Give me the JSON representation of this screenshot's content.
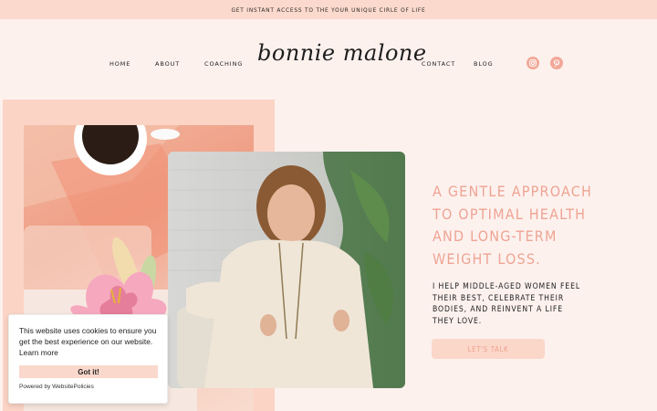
{
  "announcement": {
    "text": "GET INSTANT ACCESS TO THE YOUR UNIQUE CIRLE OF LIFE"
  },
  "nav": {
    "left": [
      {
        "label": "HOME"
      },
      {
        "label": "ABOUT"
      },
      {
        "label": "COACHING"
      }
    ],
    "right": [
      {
        "label": "CONTACT"
      },
      {
        "label": "BLOG"
      }
    ]
  },
  "logo": {
    "text": "bonnie malone"
  },
  "social": [
    {
      "icon": "instagram-icon"
    },
    {
      "icon": "pinterest-icon"
    }
  ],
  "hero": {
    "heading": "A GENTLE APPROACH TO OPTIMAL HEALTH AND LONG-TERM WEIGHT LOSS.",
    "subtext": "I HELP MIDDLE-AGED WOMEN FEEL THEIR BEST, CELEBRATE THEIR BODIES, AND REINVENT A LIFE THEY LOVE.",
    "cta_label": "LET'S TALK"
  },
  "cookie": {
    "message": "This website uses cookies to ensure you get the best experience on our website.",
    "learn_more": "Learn more",
    "button_label": "Got it!",
    "powered_by": "Powered by WebsitePolicies"
  },
  "colors": {
    "accent": "#eea493",
    "banner_bg": "#fbd9cc",
    "page_bg": "#fdf1ee"
  }
}
